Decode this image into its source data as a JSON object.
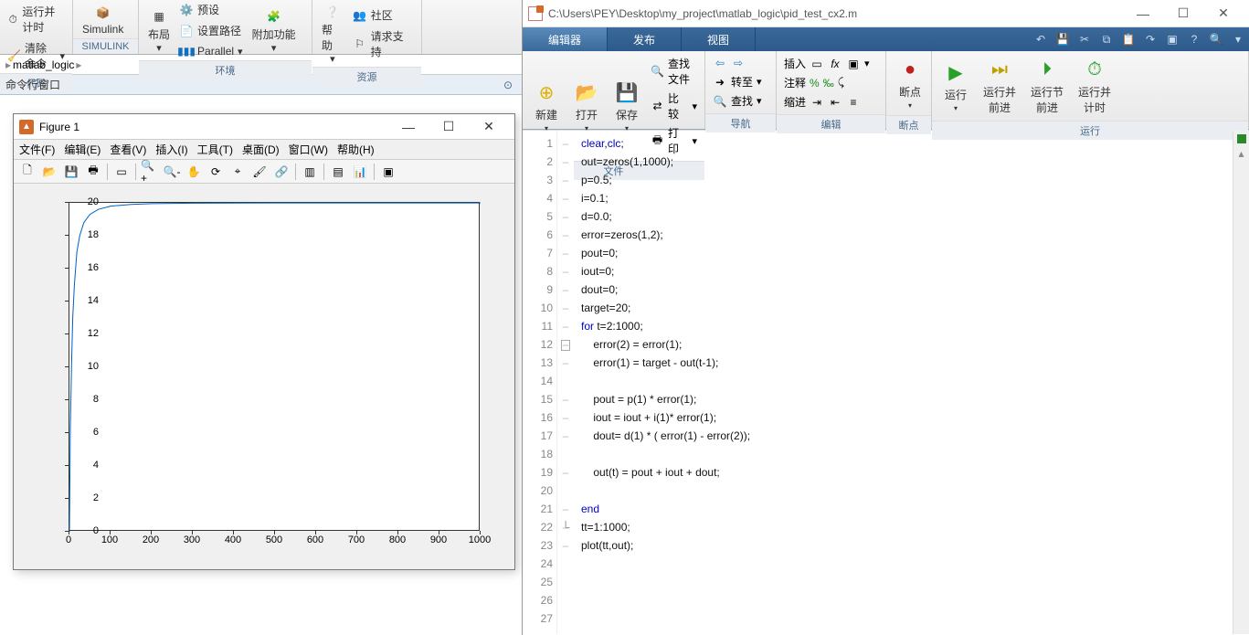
{
  "matlab": {
    "ribbon": {
      "btn_run_time": "运行并计时",
      "btn_clear": "清除命令",
      "btn_simulink": "Simulink",
      "btn_layout": "布局",
      "btn_setpath": "设置路径",
      "btn_parallel": "Parallel",
      "btn_addons": "附加功能",
      "btn_help": "帮助",
      "btn_community": "社区",
      "btn_support": "请求支持",
      "group_code": "代码",
      "group_simulink": "SIMULINK",
      "group_env": "环境",
      "group_res": "资源"
    },
    "path_item": "matlab_logic",
    "cmdwin_title": "命令行窗口"
  },
  "figure": {
    "title": "Figure 1",
    "menu": {
      "file": "文件(F)",
      "edit": "编辑(E)",
      "view": "查看(V)",
      "insert": "插入(I)",
      "tools": "工具(T)",
      "desktop": "桌面(D)",
      "window": "窗口(W)",
      "help": "帮助(H)"
    },
    "yticks": [
      "0",
      "2",
      "4",
      "6",
      "8",
      "10",
      "12",
      "14",
      "16",
      "18",
      "20"
    ],
    "xticks": [
      "0",
      "100",
      "200",
      "300",
      "400",
      "500",
      "600",
      "700",
      "800",
      "900",
      "1000"
    ]
  },
  "editor": {
    "path": "C:\\Users\\PEY\\Desktop\\my_project\\matlab_logic\\pid_test_cx2.m",
    "tabs": {
      "editor": "编辑器",
      "publish": "发布",
      "view": "视图"
    },
    "ribbon": {
      "new": "新建",
      "open": "打开",
      "save": "保存",
      "findfiles": "查找文件",
      "compare": "比较",
      "print": "打印",
      "goto": "转至",
      "find": "查找",
      "insert": "插入",
      "comment": "注释",
      "indent": "缩进",
      "breakpoint": "断点",
      "run": "运行",
      "runadvance": "运行并\n前进",
      "advance": "运行节\n前进",
      "runtime": "运行并\n计时",
      "group_file": "文件",
      "group_nav": "导航",
      "group_edit": "编辑",
      "group_bp": "断点",
      "group_run": "运行"
    },
    "code": [
      "clear,clc;",
      "out=zeros(1,1000);",
      "p=0.5;",
      "i=0.1;",
      "d=0.0;",
      "error=zeros(1,2);",
      "pout=0;",
      "iout=0;",
      "dout=0;",
      "target=20;",
      "for t=2:1000;",
      "    error(2) = error(1);",
      "    error(1) = target - out(t-1);",
      "",
      "    pout = p(1) * error(1);",
      "    iout = iout + i(1)* error(1);",
      "    dout= d(1) * ( error(1) - error(2));",
      "",
      "    out(t) = pout + iout + dout;",
      "",
      "end",
      "tt=1:1000;",
      "plot(tt,out);",
      "",
      "",
      "",
      ""
    ]
  },
  "chart_data": {
    "type": "line",
    "xlim": [
      0,
      1000
    ],
    "ylim": [
      0,
      20
    ],
    "x": [
      0,
      2,
      5,
      8,
      12,
      18,
      25,
      35,
      50,
      70,
      100,
      150,
      200,
      300,
      500,
      1000
    ],
    "y": [
      0,
      6,
      10,
      13,
      15,
      17,
      18,
      18.8,
      19.3,
      19.6,
      19.8,
      19.9,
      19.95,
      19.98,
      19.99,
      19.99
    ],
    "title": "",
    "xlabel": "",
    "ylabel": ""
  }
}
